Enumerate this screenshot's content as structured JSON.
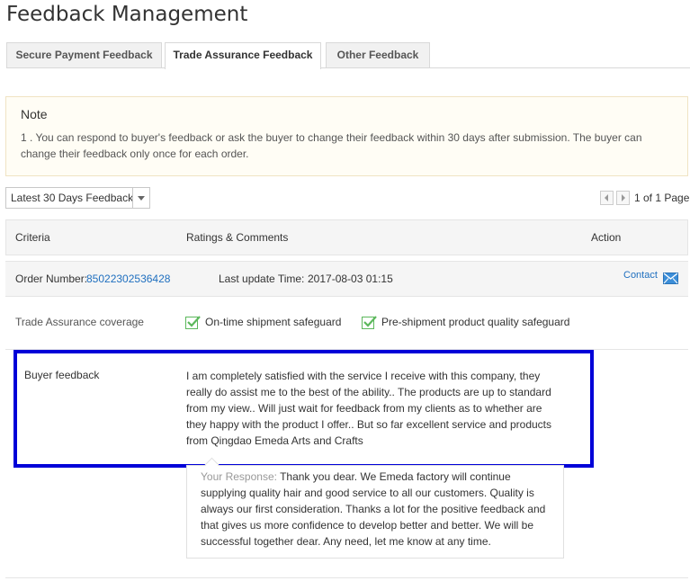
{
  "page_title": "Feedback Management",
  "tabs": [
    {
      "label": "Secure Payment Feedback"
    },
    {
      "label": "Trade Assurance Feedback"
    },
    {
      "label": "Other Feedback"
    }
  ],
  "note": {
    "title": "Note",
    "text": "1 . You can respond to buyer's feedback or ask the buyer to change their feedback within 30 days after submission. The buyer can change their feedback only once for each order."
  },
  "filter": {
    "selected": "Latest 30 Days Feedback"
  },
  "pager": {
    "text": "1 of 1 Page"
  },
  "table": {
    "headers": {
      "criteria": "Criteria",
      "ratings": "Ratings & Comments",
      "action": "Action"
    }
  },
  "order": {
    "number_label": "Order Number:",
    "number": "85022302536428",
    "update_label": "Last update Time:",
    "update_time": "2017-08-03 01:15",
    "action_text": "Contact"
  },
  "coverage": {
    "label": "Trade Assurance coverage",
    "items": [
      "On-time shipment safeguard",
      "Pre-shipment product quality safeguard"
    ]
  },
  "feedback": {
    "label": "Buyer feedback",
    "text": "I am completely satisfied with the service I receive with this company, they really do assist me to the best of the ability.. The products are up to standard from my view.. Will just wait for feedback from my clients as to whether are they happy with the product I offer.. But so far excellent service and products from Qingdao Emeda Arts and Crafts"
  },
  "response": {
    "label": "Your Response:",
    "text": "Thank you dear. We Emeda factory will continue supplying quality hair and good service to all our customers. Quality is always our first consideration. Thanks a lot for the positive feedback and that gives us more confidence to develop better and better. We will be successful together dear. Any need, let me know at any time."
  },
  "colors": {
    "link": "#1f6fbf",
    "check": "#5cb85c",
    "highlight": "#0000d8"
  }
}
